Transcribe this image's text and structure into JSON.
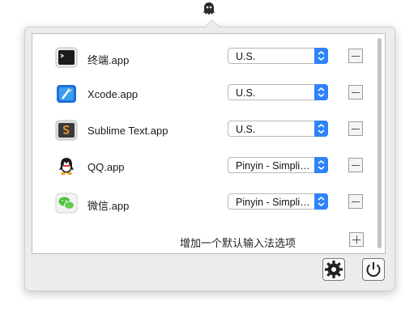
{
  "menubar": {
    "icon": "ghost-icon"
  },
  "rows": [
    {
      "app": "终端.app",
      "icon": "terminal-app-icon",
      "input": "U.S."
    },
    {
      "app": "Xcode.app",
      "icon": "xcode-app-icon",
      "input": "U.S."
    },
    {
      "app": "Sublime Text.app",
      "icon": "sublime-text-app-icon",
      "input": "U.S."
    },
    {
      "app": "QQ.app",
      "icon": "qq-app-icon",
      "input": "Pinyin - Simplified"
    },
    {
      "app": "微信.app",
      "icon": "wechat-app-icon",
      "input": "Pinyin - Simplified"
    }
  ],
  "add_option_label": "增加一个默认输入法选项",
  "footer": {
    "settings_icon": "gear-icon",
    "quit_icon": "power-icon"
  },
  "colors": {
    "accent": "#2e84f6",
    "panel": "#ececec"
  }
}
